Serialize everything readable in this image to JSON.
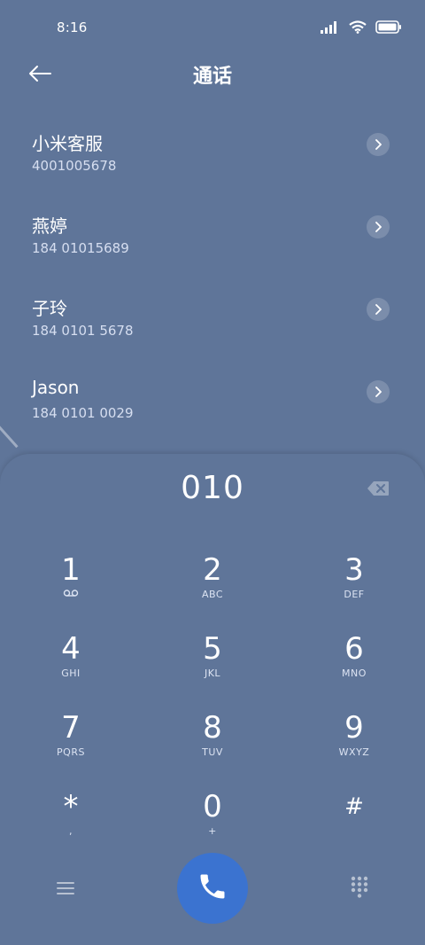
{
  "status": {
    "time": "8:16"
  },
  "header": {
    "title": "通话"
  },
  "contacts": [
    {
      "name": "小米客服",
      "number": "4001005678"
    },
    {
      "name": "燕婷",
      "number": "184 01015689"
    },
    {
      "name": "子玲",
      "number": "184 0101 5678"
    },
    {
      "name": "Jason",
      "number": "184 0101 0029"
    }
  ],
  "dialer": {
    "input": "010",
    "keys": [
      {
        "digit": "1",
        "letters": ""
      },
      {
        "digit": "2",
        "letters": "ABC"
      },
      {
        "digit": "3",
        "letters": "DEF"
      },
      {
        "digit": "4",
        "letters": "GHI"
      },
      {
        "digit": "5",
        "letters": "JKL"
      },
      {
        "digit": "6",
        "letters": "MNO"
      },
      {
        "digit": "7",
        "letters": "PQRS"
      },
      {
        "digit": "8",
        "letters": "TUV"
      },
      {
        "digit": "9",
        "letters": "WXYZ"
      },
      {
        "digit": "*",
        "letters": ","
      },
      {
        "digit": "0",
        "letters": "+"
      },
      {
        "digit": "#",
        "letters": ""
      }
    ]
  },
  "icons": {
    "back": "arrow-left-icon",
    "chevron": "chevron-right-icon",
    "backspace": "backspace-icon",
    "voicemail": "voicemail-icon",
    "menu": "menu-icon",
    "call": "phone-icon",
    "dialpad": "dialpad-icon"
  },
  "colors": {
    "background": "#5f7599",
    "call_button": "#3b73d0"
  }
}
